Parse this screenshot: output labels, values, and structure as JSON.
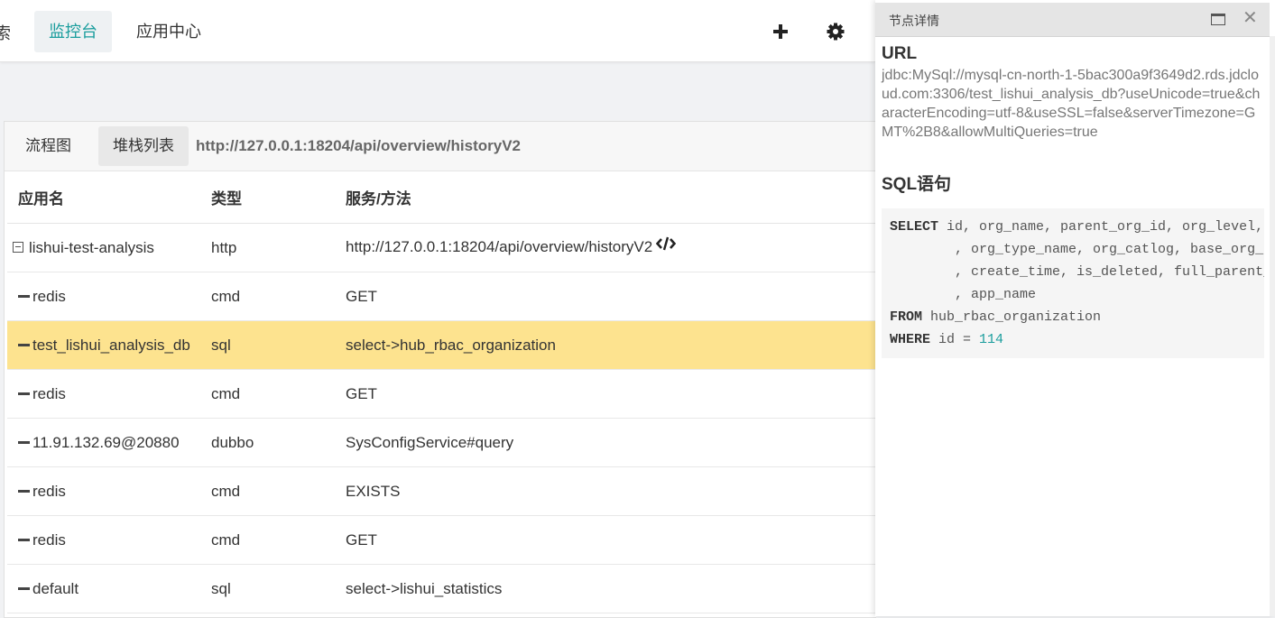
{
  "topnav": {
    "cut_label": "索",
    "tabs": [
      {
        "label": "监控台",
        "active": true
      },
      {
        "label": "应用中心",
        "active": false
      }
    ],
    "icons": [
      "plus-icon",
      "gear-icon"
    ]
  },
  "card": {
    "tabs": [
      {
        "label": "流程图",
        "active": false
      },
      {
        "label": "堆栈列表",
        "active": true
      }
    ],
    "url": "http://127.0.0.1:18204/api/overview/historyV2",
    "columns": [
      "应用名",
      "类型",
      "服务/方法"
    ],
    "rows": [
      {
        "name": "lishui-test-analysis",
        "type": "http",
        "method": "http://127.0.0.1:18204/api/overview/historyV2",
        "root": true
      },
      {
        "name": "redis",
        "type": "cmd",
        "method": "GET"
      },
      {
        "name": "test_lishui_analysis_db",
        "type": "sql",
        "method": "select->hub_rbac_organization",
        "highlighted": true
      },
      {
        "name": "redis",
        "type": "cmd",
        "method": "GET"
      },
      {
        "name": "11.91.132.69@20880",
        "type": "dubbo",
        "method": "SysConfigService#query"
      },
      {
        "name": "redis",
        "type": "cmd",
        "method": "EXISTS"
      },
      {
        "name": "redis",
        "type": "cmd",
        "method": "GET"
      },
      {
        "name": "default",
        "type": "sql",
        "method": "select->lishui_statistics"
      }
    ],
    "highlight_color": "#fde38f",
    "accent_color": "#1a9d9d"
  },
  "panel": {
    "title": "节点详情",
    "url_heading": "URL",
    "url_value": "jdbc:MySql://mysql-cn-north-1-5bac300a9f3649d2.rds.jdcloud.com:3306/test_lishui_analysis_db?useUnicode=true&characterEncoding=utf-8&useSSL=false&serverTimezone=GMT%2B8&allowMultiQueries=true",
    "sql_heading": "SQL语句",
    "sql_lines": [
      {
        "kw": "SELECT",
        "text": " id, org_name, parent_org_id, org_level,"
      },
      {
        "kw": "",
        "text": "        , org_type_name, org_catlog, base_org_c"
      },
      {
        "kw": "",
        "text": "        , create_time, is_deleted, full_parent_"
      },
      {
        "kw": "",
        "text": "        , app_name"
      },
      {
        "kw": "FROM",
        "text": " hub_rbac_organization"
      },
      {
        "kw": "WHERE",
        "text": " id = ",
        "num": "114"
      }
    ]
  }
}
